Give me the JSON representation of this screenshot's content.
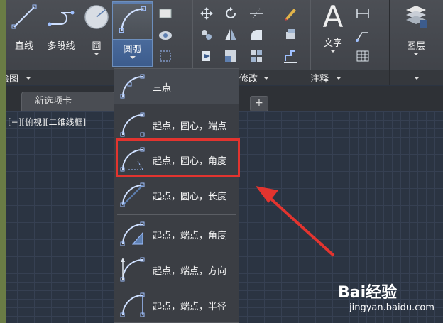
{
  "ribbon": {
    "draw_panel": {
      "title": "绘图",
      "tools": {
        "line": "直线",
        "polyline": "多段线",
        "circle": "圆",
        "arc": "圆弧"
      }
    },
    "modify_panel": {
      "title": "修改"
    },
    "annotation_panel": {
      "title": "注释",
      "text_tool": "文字",
      "text_glyph": "A"
    },
    "layers_panel": {
      "layers_tool": "图层"
    }
  },
  "tabs": {
    "new_tab": "新选项卡",
    "add_tab": "+"
  },
  "viewport": {
    "label": "[−][俯视][二维线框]"
  },
  "arc_menu": {
    "items": [
      {
        "label": "三点"
      },
      {
        "label": "起点，圆心，端点"
      },
      {
        "label": "起点，圆心，角度"
      },
      {
        "label": "起点，圆心，长度"
      },
      {
        "label": "起点，端点，角度"
      },
      {
        "label": "起点，端点，方向"
      },
      {
        "label": "起点，端点，半径"
      }
    ],
    "highlighted_index": 2
  },
  "watermark": {
    "brand": "Bai经验",
    "url": "jingyan.baidu.com"
  },
  "colors": {
    "accent_blue": "#5e7fb0",
    "highlight_red": "#e3342f",
    "canvas": "#2b3442"
  }
}
